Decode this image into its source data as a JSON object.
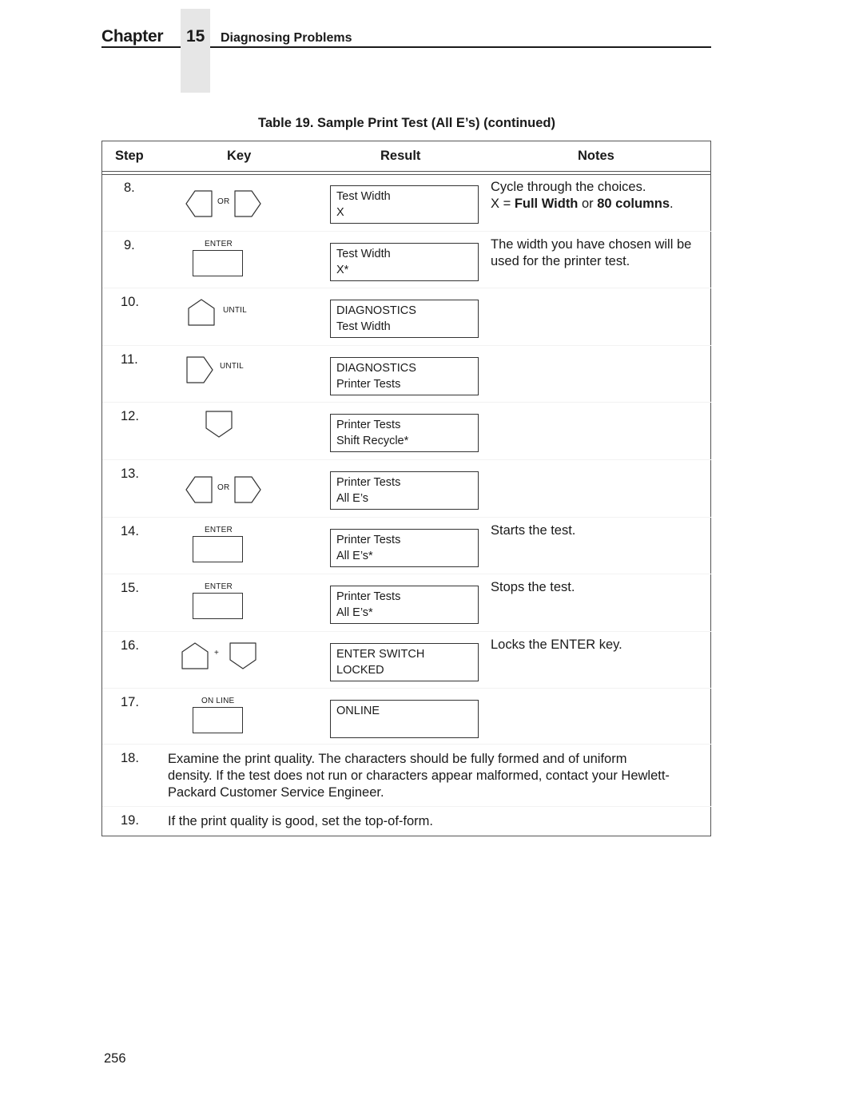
{
  "header": {
    "chapter_word": "Chapter",
    "chapter_number": "15",
    "chapter_title": "Diagnosing Problems"
  },
  "table": {
    "caption": "Table 19. Sample Print Test (All E’s) (continued)",
    "columns": [
      "Step",
      "Key",
      "Result",
      "Notes"
    ],
    "rows": [
      {
        "step": "8.",
        "key": {
          "icon": "left-or-right-keys",
          "label": "OR"
        },
        "result": [
          "Test Width",
          "X"
        ],
        "notes": {
          "line1": "Cycle through the choices.",
          "line2_pre": "X = ",
          "bold1": "Full Width",
          "mid": " or ",
          "bold2": "80 columns",
          "end": "."
        }
      },
      {
        "step": "9.",
        "key": {
          "icon": "enter-key",
          "label": "ENTER"
        },
        "result": [
          "Test Width",
          "X*"
        ],
        "notes": {
          "text": "The width you have chosen will be used for the printer test."
        }
      },
      {
        "step": "10.",
        "key": {
          "icon": "up-key",
          "label": "UNTIL"
        },
        "result": [
          "DIAGNOSTICS",
          "Test Width"
        ],
        "notes": {
          "text": ""
        }
      },
      {
        "step": "11.",
        "key": {
          "icon": "right-key",
          "label": "UNTIL"
        },
        "result": [
          "DIAGNOSTICS",
          "Printer Tests"
        ],
        "notes": {
          "text": ""
        }
      },
      {
        "step": "12.",
        "key": {
          "icon": "down-key",
          "label": ""
        },
        "result": [
          "Printer Tests",
          "Shift Recycle*"
        ],
        "notes": {
          "text": ""
        }
      },
      {
        "step": "13.",
        "key": {
          "icon": "left-or-right-keys",
          "label": "OR"
        },
        "result": [
          "Printer Tests",
          "All E’s"
        ],
        "notes": {
          "text": ""
        }
      },
      {
        "step": "14.",
        "key": {
          "icon": "enter-key",
          "label": "ENTER"
        },
        "result": [
          "Printer Tests",
          "All E’s*"
        ],
        "notes": {
          "text": "Starts the test."
        }
      },
      {
        "step": "15.",
        "key": {
          "icon": "enter-key",
          "label": "ENTER"
        },
        "result": [
          "Printer Tests",
          "All E’s*"
        ],
        "notes": {
          "text": "Stops the test."
        }
      },
      {
        "step": "16.",
        "key": {
          "icon": "up-plus-down-keys",
          "label": "+"
        },
        "result": [
          "ENTER SWITCH",
          "LOCKED"
        ],
        "notes": {
          "text": "Locks the ENTER key."
        }
      },
      {
        "step": "17.",
        "key": {
          "icon": "online-key",
          "label": "ON LINE"
        },
        "result": [
          "ONLINE",
          ""
        ],
        "notes": {
          "text": ""
        }
      }
    ],
    "wide_rows": [
      {
        "step": "18.",
        "lines": [
          "Examine the print quality. The characters should be fully formed and of uniform",
          "density. If the test does not run or characters appear malformed, contact your Hewlett-",
          "Packard Customer Service Engineer."
        ]
      },
      {
        "step": "19.",
        "lines": [
          "If the print quality is good, set the top-of-form."
        ]
      }
    ]
  },
  "page_number": "256"
}
